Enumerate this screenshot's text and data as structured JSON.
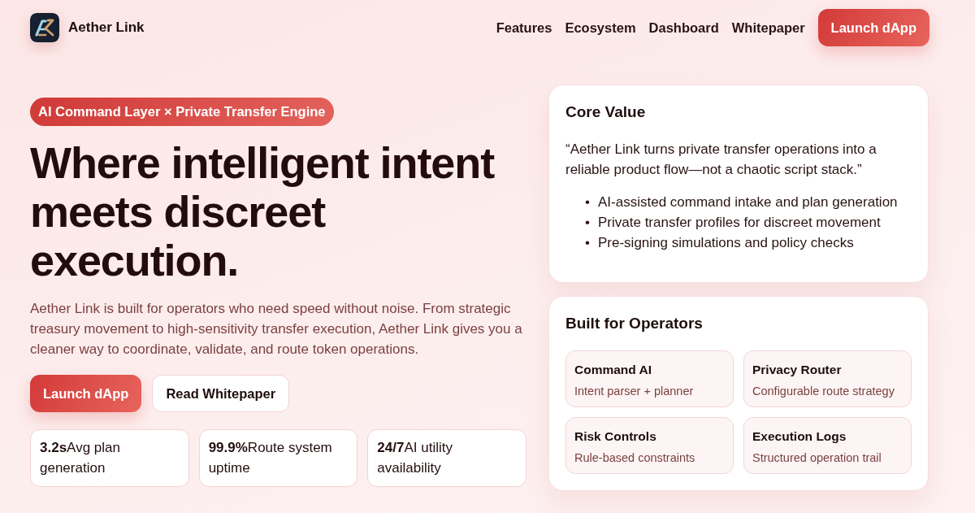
{
  "header": {
    "brand": "Aether Link",
    "nav_links": [
      "Features",
      "Ecosystem",
      "Dashboard",
      "Whitepaper"
    ],
    "cta": "Launch dApp"
  },
  "hero": {
    "badge": "AI Command Layer × Private Transfer Engine",
    "heading": "Where intelligent intent meets discreet execution.",
    "description": "Aether Link is built for operators who need speed without noise. From strategic treasury movement to high-sensitivity transfer execution, Aether Link gives you a cleaner way to coordinate, validate, and route token operations.",
    "buttons": [
      {
        "label": "Launch dApp",
        "kind": "primary"
      },
      {
        "label": "Read Whitepaper",
        "kind": "secondary"
      }
    ],
    "stats": [
      {
        "text": "**3.2s**Avg plan generation"
      },
      {
        "text": "**99.9%**Route system uptime"
      },
      {
        "text": "**24/7**AI utility availability"
      }
    ]
  },
  "core_value": {
    "title": "Core Value",
    "quote": "“Aether Link turns private transfer operations into a reliable product flow—not a chaotic script stack.”",
    "points": [
      {
        "marker": "•",
        "text": "AI-assisted command intake and plan generation"
      },
      {
        "marker": "•",
        "text": "Private transfer profiles for discreet movement"
      },
      {
        "marker": "•",
        "text": "Pre-signing simulations and policy checks"
      }
    ]
  },
  "operators": {
    "title": "Built for Operators",
    "features": [
      {
        "title": "Command AI",
        "description": "Intent parser + planner"
      },
      {
        "title": "Privacy Router",
        "description": "Configurable route strategy"
      },
      {
        "title": "Risk Controls",
        "description": "Rule-based constraints"
      },
      {
        "title": "Execution Logs",
        "description": "Structured operation trail"
      }
    ]
  }
}
